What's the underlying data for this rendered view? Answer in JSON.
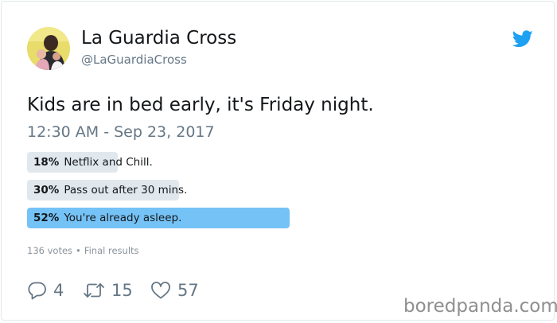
{
  "author": {
    "display_name": "La Guardia Cross",
    "handle": "@LaGuardiaCross",
    "avatar_icon": "profile-photo",
    "platform_icon": "twitter-bird-icon",
    "platform_color": "#1da1f2"
  },
  "tweet": {
    "text": "Kids are in bed early, it's Friday night.",
    "timestamp": "12:30 AM - Sep 23, 2017"
  },
  "poll": {
    "options": [
      {
        "percent_label": "18%",
        "label": "Netflix and Chill.",
        "fraction": 0.18,
        "winner": false
      },
      {
        "percent_label": "30%",
        "label": "Pass out after 30 mins.",
        "fraction": 0.3,
        "winner": false
      },
      {
        "percent_label": "52%",
        "label": "You're already asleep.",
        "fraction": 0.52,
        "winner": true
      }
    ],
    "votes": "136 votes",
    "separator": "•",
    "status": "Final results",
    "colors": {
      "winner": "#75c2f6",
      "other": "#e1e8ed"
    }
  },
  "actions": {
    "reply": {
      "icon": "reply-icon",
      "count": "4"
    },
    "retweet": {
      "icon": "retweet-icon",
      "count": "15"
    },
    "like": {
      "icon": "heart-icon",
      "count": "57"
    }
  },
  "watermark": "boredpanda.com"
}
